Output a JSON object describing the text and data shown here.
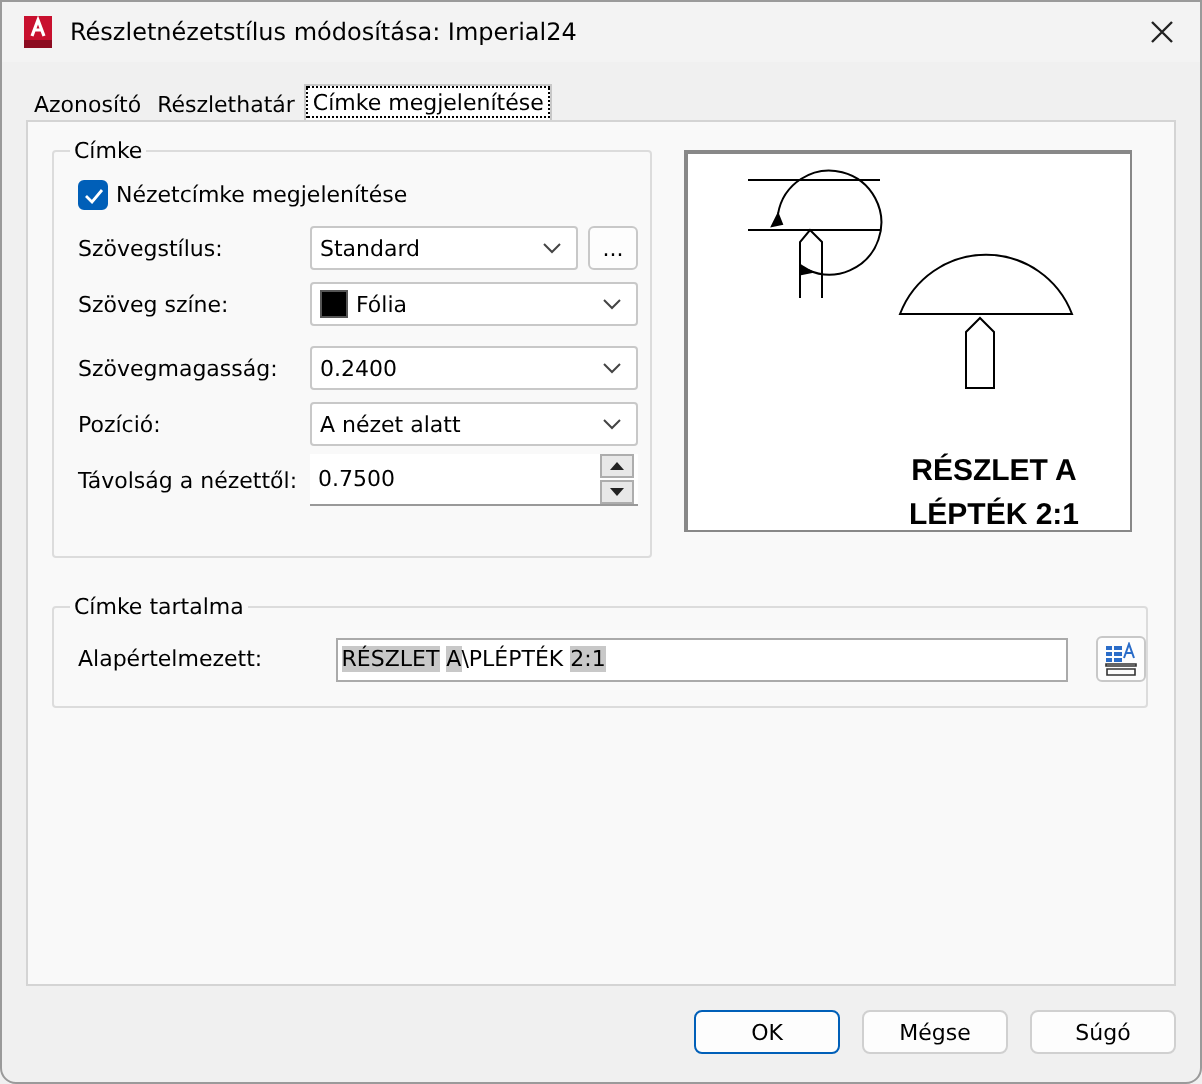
{
  "window": {
    "title": "Részletnézetstílus módosítása: Imperial24"
  },
  "tabs": [
    {
      "label": "Azonosító",
      "selected": false
    },
    {
      "label": "Részlethatár",
      "selected": false
    },
    {
      "label": "Címke megjelenítése",
      "selected": true
    }
  ],
  "label_group": {
    "title": "Címke",
    "show_label": {
      "label": "Nézetcímke megjelenítése",
      "checked": true
    },
    "fields": [
      {
        "kind": "combo",
        "label": "Szövegstílus:",
        "value": "Standard",
        "extra": "..."
      },
      {
        "kind": "color",
        "label": "Szöveg színe:",
        "value": "Fólia",
        "color": "#000000"
      },
      {
        "kind": "combo",
        "label": "Szövegmagasság:",
        "value": "0.2400"
      },
      {
        "kind": "combo",
        "label": "Pozíció:",
        "value": "A nézet alatt"
      },
      {
        "kind": "spinner",
        "label": "Távolság a nézettől:",
        "value": "0.7500"
      }
    ]
  },
  "preview": {
    "lines": [
      "RÉSZLET A",
      "LÉPTÉK 2:1"
    ]
  },
  "content_group": {
    "title": "Címke tartalma",
    "label": "Alapértelmezett:",
    "segments": [
      {
        "text": "RÉSZLET",
        "highlighted": true
      },
      {
        "text": "A",
        "highlighted": true,
        "space_before": true
      },
      {
        "text": "\\PLÉPTÉK ",
        "highlighted": false
      },
      {
        "text": "2:1",
        "highlighted": true
      }
    ]
  },
  "buttons": [
    {
      "label": "OK",
      "default": true
    },
    {
      "label": "Mégse",
      "default": false
    },
    {
      "label": "Súgó",
      "default": false
    }
  ]
}
